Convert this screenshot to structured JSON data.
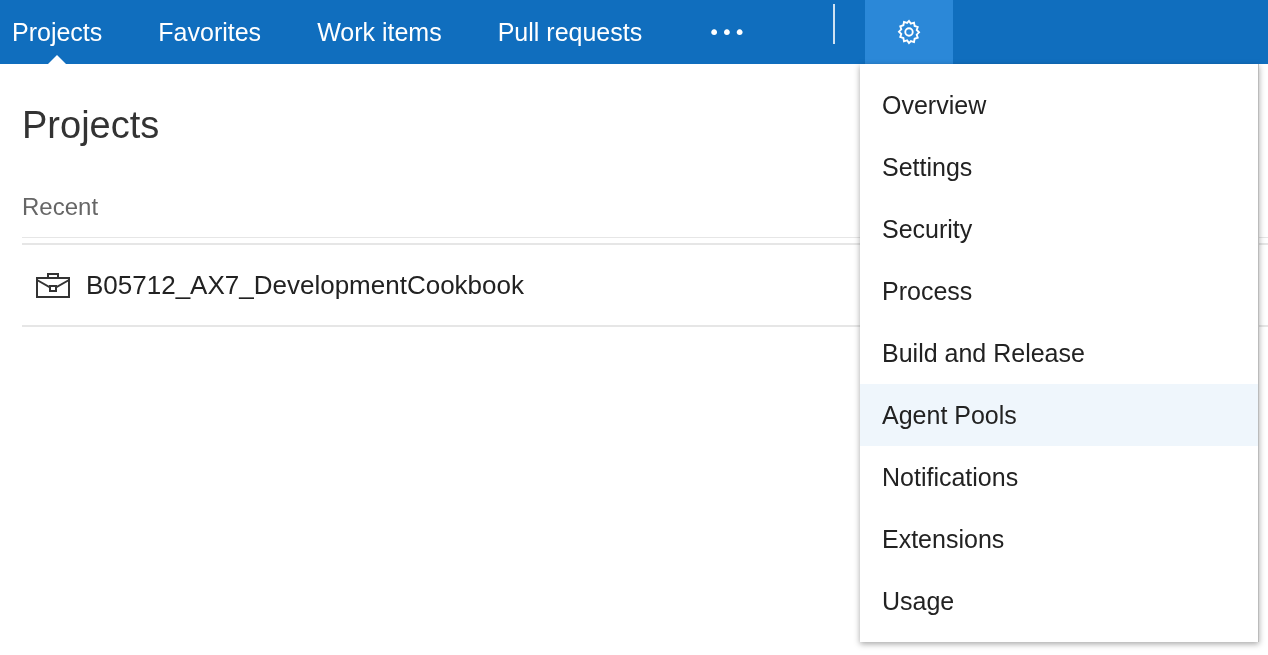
{
  "nav": {
    "tabs": [
      {
        "label": "Projects",
        "selected": true
      },
      {
        "label": "Favorites",
        "selected": false
      },
      {
        "label": "Work items",
        "selected": false
      },
      {
        "label": "Pull requests",
        "selected": false
      }
    ],
    "more": "•••"
  },
  "settings_menu": {
    "open": true,
    "items": [
      {
        "label": "Overview",
        "highlighted": false
      },
      {
        "label": "Settings",
        "highlighted": false
      },
      {
        "label": "Security",
        "highlighted": false
      },
      {
        "label": "Process",
        "highlighted": false
      },
      {
        "label": "Build and Release",
        "highlighted": false
      },
      {
        "label": "Agent Pools",
        "highlighted": true
      },
      {
        "label": "Notifications",
        "highlighted": false
      },
      {
        "label": "Extensions",
        "highlighted": false
      },
      {
        "label": "Usage",
        "highlighted": false
      }
    ]
  },
  "page": {
    "title": "Projects",
    "section": "Recent",
    "projects": [
      {
        "name": "B05712_AX7_DevelopmentCookbook"
      }
    ]
  }
}
